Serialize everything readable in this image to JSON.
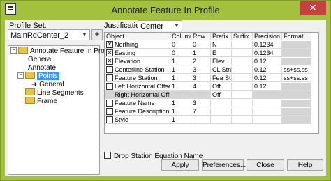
{
  "window": {
    "title": "Annotate Feature In Profile",
    "close_label": "✕"
  },
  "profile_set": {
    "label": "Profile Set:",
    "value": "MainRdCenter_2"
  },
  "justification": {
    "label": "Justification:",
    "value": "Center Center"
  },
  "add_button": {
    "label": "+"
  },
  "tree": {
    "root": "Annotate Feature In Profile",
    "items": [
      "General",
      "Annotate",
      "Points",
      "General",
      "Line Segments",
      "Frame"
    ]
  },
  "grid": {
    "headers": [
      "Object",
      "Column",
      "Row",
      "Prefix",
      "Suffix",
      "Precision",
      "Format"
    ],
    "rows": [
      {
        "checked": true,
        "object": "Northing",
        "column": "0",
        "row": "0",
        "prefix": "N",
        "suffix": "",
        "precision": "0.1234",
        "format": ""
      },
      {
        "checked": true,
        "object": "Easting",
        "column": "0",
        "row": "1",
        "prefix": "E",
        "suffix": "",
        "precision": "0.1234",
        "format": ""
      },
      {
        "checked": true,
        "object": "Elevation",
        "column": "1",
        "row": "2",
        "prefix": "Elev",
        "suffix": "",
        "precision": "0.12",
        "format": ""
      },
      {
        "checked": false,
        "object": "Centerline Station",
        "column": "1",
        "row": "3",
        "prefix": "CL Stn",
        "suffix": "",
        "precision": "0.12",
        "format": "ss+ss.ss"
      },
      {
        "checked": false,
        "object": "Feature Station",
        "column": "1",
        "row": "3",
        "prefix": "Fea Stn",
        "suffix": "",
        "precision": "0.12",
        "format": "ss+ss.ss"
      },
      {
        "checked": false,
        "object": "Left Horizontal Offset",
        "column": "1",
        "row": "4",
        "prefix": "Off",
        "suffix": "",
        "precision": "0.12",
        "format": ""
      },
      {
        "checked": null,
        "object": "Right Horizontal Offset",
        "column": "",
        "row": "",
        "prefix": "Off",
        "suffix": "",
        "precision": "",
        "format": ""
      },
      {
        "checked": false,
        "object": "Feature Name",
        "column": "1",
        "row": "3",
        "prefix": "",
        "suffix": "",
        "precision": "",
        "format": ""
      },
      {
        "checked": false,
        "object": "Feature Description",
        "column": "1",
        "row": "7",
        "prefix": "",
        "suffix": "",
        "precision": "",
        "format": ""
      },
      {
        "checked": false,
        "object": "Style",
        "column": "1",
        "row": "",
        "prefix": "",
        "suffix": "",
        "precision": "",
        "format": ""
      }
    ]
  },
  "drop_station": {
    "label": "Drop Station Equation Name"
  },
  "buttons": {
    "apply": "Apply",
    "preferences": "Preferences...",
    "close": "Close",
    "help": "Help"
  }
}
